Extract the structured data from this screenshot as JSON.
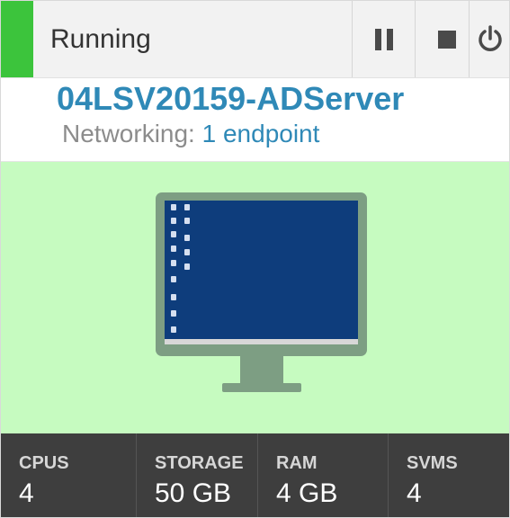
{
  "vm": {
    "status": "Running",
    "name": "04LSV20159-ADServer",
    "networking_label": "Networking:",
    "endpoint_link": "1 endpoint"
  },
  "controls": {
    "pause_icon": "pause-icon",
    "stop_icon": "stop-icon",
    "power_icon": "power-icon"
  },
  "stats": [
    {
      "label": "CPUS",
      "value": "4"
    },
    {
      "label": "STORAGE",
      "value": "50 GB"
    },
    {
      "label": "RAM",
      "value": "4 GB"
    },
    {
      "label": "SVMS",
      "value": "4"
    }
  ],
  "colors": {
    "status_running": "#3cc43c",
    "accent_link": "#2f89b7",
    "preview_background": "#c6fbc0",
    "stats_background": "#3e3e3e"
  }
}
